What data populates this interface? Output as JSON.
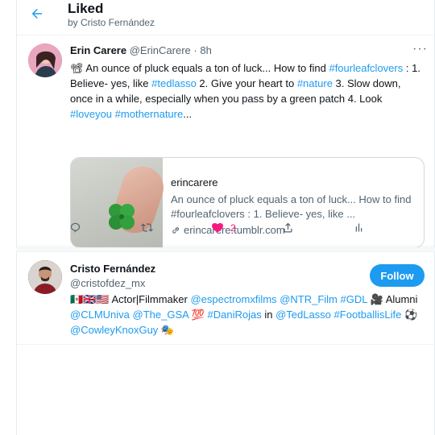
{
  "header": {
    "title": "Liked",
    "subtitle": "by Cristo Fernández"
  },
  "tweet": {
    "author_name": "Erin Carere",
    "author_handle": "@ErinCarere",
    "separator": "·",
    "time": "8h",
    "more": "···",
    "text_parts": [
      {
        "text": "📽 An ounce of pluck equals a ton of luck... How to find ",
        "type": "text"
      },
      {
        "text": "#fourleafclovers",
        "type": "hashtag"
      },
      {
        "text": " : 1. Believe- yes, like ",
        "type": "text"
      },
      {
        "text": "#tedlasso",
        "type": "hashtag"
      },
      {
        "text": " 2. Give your heart to ",
        "type": "text"
      },
      {
        "text": "#nature",
        "type": "hashtag"
      },
      {
        "text": " 3. Slow down, once in a while, especially when you pass by a green patch 4. Look ",
        "type": "text"
      },
      {
        "text": "#loveyou",
        "type": "hashtag"
      },
      {
        "text": " ",
        "type": "text"
      },
      {
        "text": "#mothernature",
        "type": "hashtag"
      },
      {
        "text": "...",
        "type": "text"
      }
    ],
    "card": {
      "domain": "erincarere",
      "description": "An ounce of pluck equals a ton of luck... How to find #fourleafclovers : 1. Believe- yes, like ...",
      "link": "erincarere.tumblr.com"
    },
    "actions": {
      "reply_icon": "reply-icon",
      "retweet_icon": "retweet-icon",
      "like_icon": "heart-filled-icon",
      "like_count": "2",
      "share_icon": "share-icon",
      "analytics_icon": "analytics-icon"
    }
  },
  "user": {
    "name": "Cristo Fernández",
    "handle": "@cristofdez_mx",
    "follow_label": "Follow",
    "bio_parts": [
      {
        "text": "🇲🇽🇬🇧🇺🇸 Actor|Filmmaker ",
        "type": "text"
      },
      {
        "text": "@espectromxfilms",
        "type": "mention"
      },
      {
        "text": " ",
        "type": "text"
      },
      {
        "text": "@NTR_Film",
        "type": "mention"
      },
      {
        "text": " ",
        "type": "text"
      },
      {
        "text": "#GDL",
        "type": "hashtag"
      },
      {
        "text": " 🎥 Alumni ",
        "type": "text"
      },
      {
        "text": "@CLMUniva",
        "type": "mention"
      },
      {
        "text": " ",
        "type": "text"
      },
      {
        "text": "@The_GSA",
        "type": "mention"
      },
      {
        "text": " 💯 ",
        "type": "text"
      },
      {
        "text": "#DaniRojas",
        "type": "hashtag"
      },
      {
        "text": " in ",
        "type": "text"
      },
      {
        "text": "@TedLasso",
        "type": "mention"
      },
      {
        "text": " ",
        "type": "text"
      },
      {
        "text": "#FootballisLife",
        "type": "hashtag"
      },
      {
        "text": " ⚽ ",
        "type": "text"
      },
      {
        "text": "@CowleyKnoxGuy",
        "type": "mention"
      },
      {
        "text": " 🎭",
        "type": "text"
      }
    ]
  },
  "colors": {
    "accent": "#1d9bf0",
    "like": "#f91880",
    "muted": "#536471"
  }
}
